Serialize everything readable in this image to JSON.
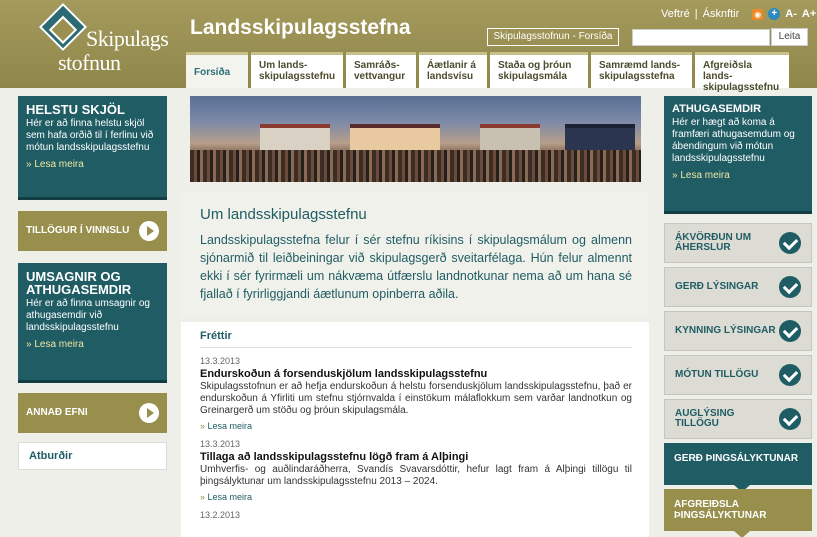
{
  "colors": {
    "teal": "#1f5c64",
    "olive": "#978f4b",
    "header": "#9a9052"
  },
  "logo": {
    "line1": "Skipulags",
    "line2": "stofnun"
  },
  "header": {
    "title": "Landsskipulagsstefna",
    "top_links": [
      "Veftré",
      "Ásknftir"
    ],
    "sep": "|",
    "rss_icon": "rss-icon",
    "font_minus": "A-",
    "font_plus": "A+",
    "home_link": "Skipulagsstofnun - Forsíða",
    "search_placeholder": "",
    "search_button": "Leita"
  },
  "tabs": [
    {
      "label": "Forsíða"
    },
    {
      "label": "Um lands-\nskipulagsstefnu"
    },
    {
      "label": "Samráðs-\nvettvangur"
    },
    {
      "label": "Áætlanir á\nlandsvísu"
    },
    {
      "label": "Staða og þróun\nskipulagsmála"
    },
    {
      "label": "Samræmd lands-\nskipulagsstefna"
    },
    {
      "label": "Afgreiðsla lands-\nskipulagsstefnu"
    }
  ],
  "left": {
    "skjol": {
      "title": "HELSTU SKJÖL",
      "text": "Hér er að finna helstu skjöl sem hafa orðið til í ferlinu við mótun landsskipulagsstefnu",
      "more": "» Lesa meira"
    },
    "tillogur": "TILLÖGUR Í VINNSLU",
    "umsagnir": {
      "title": "UMSAGNIR OG ATHUGASEMDIR",
      "text": "Hér er að finna umsagnir og athugasemdir við landsskipulagsstefnu",
      "more": "» Lesa meira"
    },
    "annad": "ANNAÐ EFNI",
    "atburdir": "Atburðir"
  },
  "intro": {
    "title": "Um landsskipulagsstefnu",
    "text": "Landsskipulagsstefna felur í sér stefnu ríkisins í skipulagsmálum og almenn sjónarmið til leiðbeiningar við skipulagsgerð sveitarfélaga. Hún felur almennt ekki í sér fyrirmæli um nákvæma útfærslu landnotkunar nema að um hana sé fjallað í fyrirliggjandi áætlunum opinberra aðila."
  },
  "news": {
    "title": "Fréttir",
    "items": [
      {
        "date": "13.3.2013",
        "title": "Endurskoðun á forsenduskjölum landsskipulagsstefnu",
        "body": "Skipulagsstofnun er að hefja endurskoðun á helstu forsenduskjölum landsskipulagsstefnu, það er endurskoðun á Yfirliti um stefnu stjórnvalda í einstökum málaflokkum sem varðar landnotkun og Greinargerð um stöðu og þróun skipulagsmála.",
        "more": "Lesa meira"
      },
      {
        "date": "13.3.2013",
        "title": "Tillaga að landsskipulagsstefnu lögð fram á Alþingi",
        "body": "Umhverfis- og auðlindaráðherra, Svandís Svavarsdóttir, hefur lagt fram á Alþingi tillögu til þingsályktunar um landsskipulagsstefnu 2013 – 2024.",
        "more": "Lesa meira"
      },
      {
        "date": "13.2.2013",
        "title": "",
        "body": "",
        "more": ""
      }
    ]
  },
  "right": {
    "athugasemdir": {
      "title": "ATHUGASEMDIR",
      "text": "Hér er hægt að koma á framfæri athugasemdum og ábendingum við mótun landsskipulagsstefnu",
      "more": "» Lesa meira"
    },
    "steps": [
      "ÁKVÖRÐUN UM ÁHERSLUR",
      "GERÐ LÝSINGAR",
      "KYNNING LÝSINGAR",
      "MÓTUN TILLÖGU",
      "AUGLÝSING TILLÖGU"
    ],
    "stage1": "GERÐ ÞINGSÁLYKTUNAR",
    "stage2": "AFGREIÐSLA ÞINGSÁLYKTUNAR"
  }
}
